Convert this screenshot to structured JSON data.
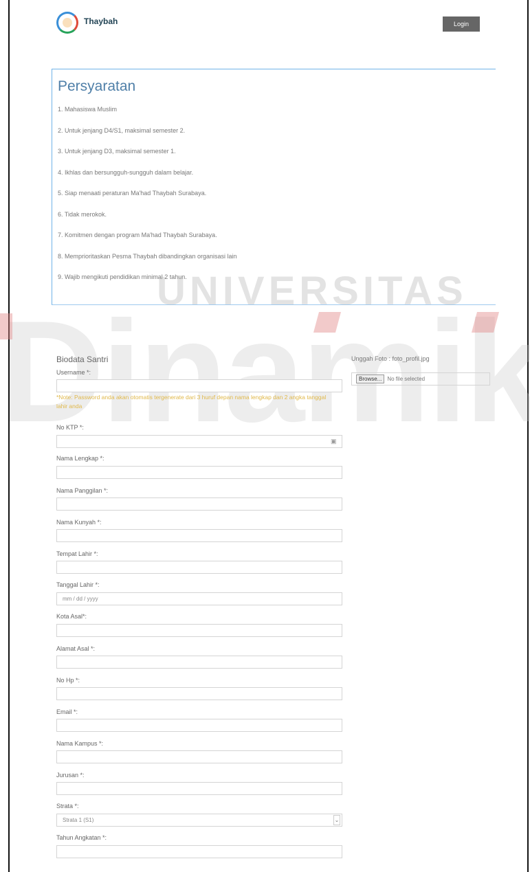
{
  "header": {
    "brand": "Thaybah",
    "login_label": "Login"
  },
  "requirements": {
    "title": "Persyaratan",
    "items": [
      "1. Mahasiswa Muslim",
      "2. Untuk jenjang D4/S1, maksimal semester 2.",
      "3. Untuk jenjang D3, maksimal semester 1.",
      "4. Ikhlas dan bersungguh-sungguh dalam belajar.",
      "5. Siap menaati peraturan Ma'had Thaybah Surabaya.",
      "6. Tidak merokok.",
      "7. Komitmen dengan program Ma'had Thaybah Surabaya.",
      "8. Memprioritaskan Pesma Thaybah dibandingkan organisasi lain",
      "9. Wajib mengikuti pendidikan minimal 2 tahun."
    ]
  },
  "watermark": {
    "line1": "UNIVERSITAS",
    "line2": "Dinamika"
  },
  "form": {
    "title": "Biodata Santri",
    "username_label": "Username *:",
    "note": "*Note: Password anda akan otomatis tergenerate dari 3 huruf depan nama lengkap dan 2 angka tanggal lahir anda",
    "no_ktp_label": "No KTP *:",
    "nama_lengkap_label": "Nama Lengkap *:",
    "nama_panggilan_label": "Nama Panggilan *:",
    "nama_kunyah_label": "Nama Kunyah *:",
    "tempat_lahir_label": "Tempat Lahir *:",
    "tanggal_lahir_label": "Tanggal Lahir *:",
    "tanggal_lahir_placeholder": "mm / dd / yyyy",
    "kota_asal_label": "Kota Asal*:",
    "alamat_asal_label": "Alamat Asal *:",
    "no_hp_label": "No Hp *:",
    "email_label": "Email *:",
    "nama_kampus_label": "Nama Kampus *:",
    "jurusan_label": "Jurusan *:",
    "strata_label": "Strata *:",
    "strata_value": "Strata 1 (S1)",
    "tahun_angkatan_label": "Tahun Angkatan *:"
  },
  "upload": {
    "label": "Unggah Foto : foto_profil.jpg",
    "browse_label": "Browse...",
    "status": "No file selected"
  }
}
